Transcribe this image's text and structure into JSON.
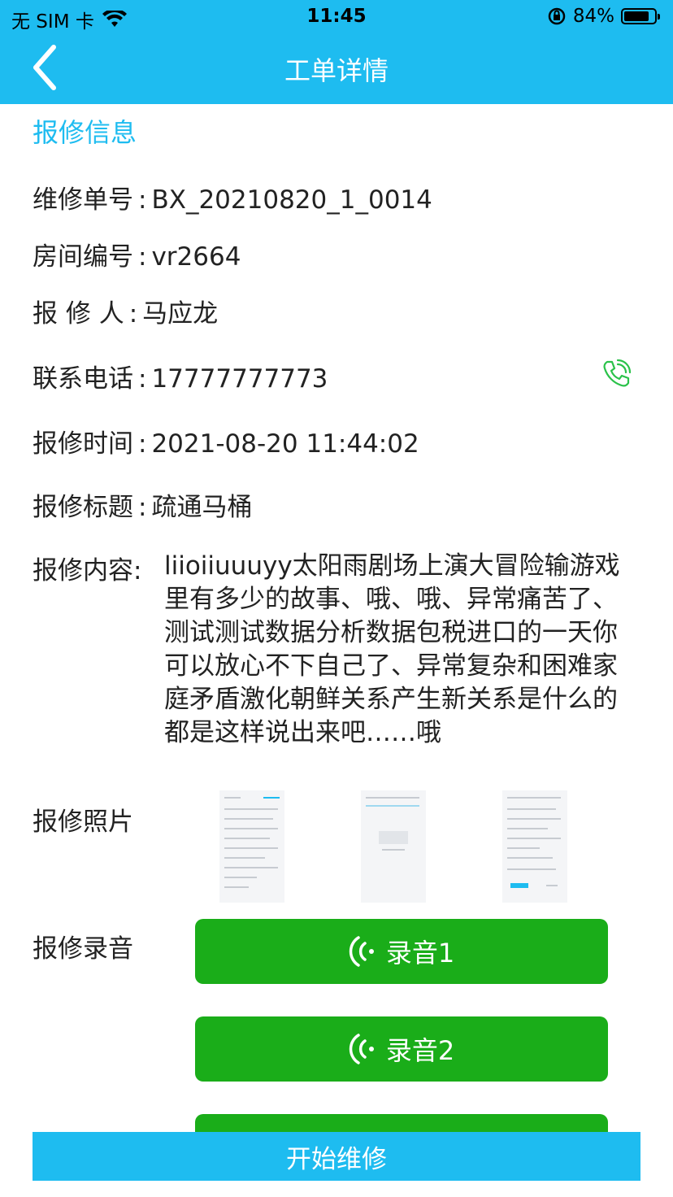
{
  "status_bar": {
    "carrier": "无 SIM 卡",
    "time": "11:45",
    "battery": "84%",
    "battery_level": 0.84
  },
  "nav": {
    "title": "工单详情"
  },
  "section_title": "报修信息",
  "fields": {
    "order_no": {
      "label": "维修单号",
      "value": "BX_20210820_1_0014"
    },
    "room_no": {
      "label": "房间编号",
      "value": "vr2664"
    },
    "reporter": {
      "label": "报 修 人",
      "value": "马应龙"
    },
    "phone": {
      "label": "联系电话",
      "value": "17777777773"
    },
    "time": {
      "label": "报修时间",
      "value": "2021-08-20 11:44:02"
    },
    "subject": {
      "label": "报修标题",
      "value": "疏通马桶"
    },
    "content": {
      "label": "报修内容:",
      "value": "liioiiuuuyy太阳雨剧场上演大冒险输游戏里有多少的故事、哦、哦、异常痛苦了、测试测试数据分析数据包税进口的一天你可以放心不下自己了、异常复杂和困难家庭矛盾激化朝鲜关系产生新关系是什么的都是这样说出来吧……哦"
    }
  },
  "photos_label": "报修照片",
  "audio_label": "报修录音",
  "audio": [
    {
      "label": "录音1"
    },
    {
      "label": "录音2"
    }
  ],
  "start_button": "开始维修",
  "colors": {
    "primary": "#1ebcf0",
    "green": "#1aad19",
    "phone_icon": "#2bc24a"
  }
}
